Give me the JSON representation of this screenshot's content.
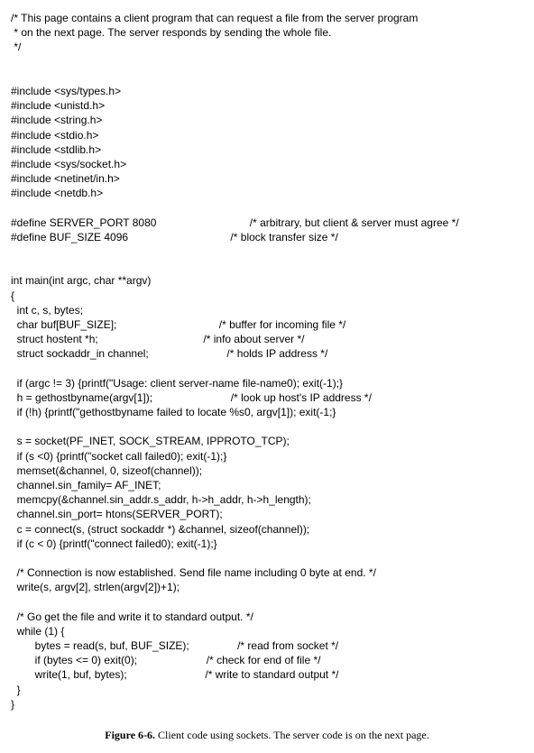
{
  "code": {
    "l01": "/* This page contains a client program that can request a file from the server program",
    "l02": " * on the next page. The server responds by sending the whole file.",
    "l03": " */",
    "l04": "",
    "l05": "",
    "l06": "#include <sys/types.h>",
    "l07": "#include <unistd.h>",
    "l08": "#include <string.h>",
    "l09": "#include <stdio.h>",
    "l10": "#include <stdlib.h>",
    "l11": "#include <sys/socket.h>",
    "l12": "#include <netinet/in.h>",
    "l13": "#include <netdb.h>",
    "l14": "",
    "l15": "#define SERVER_PORT 8080                               /* arbitrary, but client & server must agree */",
    "l16": "#define BUF_SIZE 4096                                  /* block transfer size */",
    "l17": "",
    "l18": "",
    "l19": "int main(int argc, char **argv)",
    "l20": "{",
    "l21": "  int c, s, bytes;",
    "l22": "  char buf[BUF_SIZE];                                  /* buffer for incoming file */",
    "l23": "  struct hostent *h;                                   /* info about server */",
    "l24": "  struct sockaddr_in channel;                          /* holds IP address */",
    "l25": "",
    "l26": "  if (argc != 3) {printf(\"Usage: client server-name file-name0); exit(-1);}",
    "l27": "  h = gethostbyname(argv[1]);                          /* look up host's IP address */",
    "l28": "  if (!h) {printf(\"gethostbyname failed to locate %s0, argv[1]); exit(-1;}",
    "l29": "",
    "l30": "  s = socket(PF_INET, SOCK_STREAM, IPPROTO_TCP);",
    "l31": "  if (s <0) {printf(\"socket call failed0); exit(-1);}",
    "l32": "  memset(&channel, 0, sizeof(channel));",
    "l33": "  channel.sin_family= AF_INET;",
    "l34": "  memcpy(&channel.sin_addr.s_addr, h->h_addr, h->h_length);",
    "l35": "  channel.sin_port= htons(SERVER_PORT);",
    "l36": "  c = connect(s, (struct sockaddr *) &channel, sizeof(channel));",
    "l37": "  if (c < 0) {printf(\"connect failed0); exit(-1);}",
    "l38": "",
    "l39": "  /* Connection is now established. Send file name including 0 byte at end. */",
    "l40": "  write(s, argv[2], strlen(argv[2])+1);",
    "l41": "",
    "l42": "  /* Go get the file and write it to standard output. */",
    "l43": "  while (1) {",
    "l44": "        bytes = read(s, buf, BUF_SIZE);                /* read from socket */",
    "l45": "        if (bytes <= 0) exit(0);                       /* check for end of file */",
    "l46": "        write(1, buf, bytes);                          /* write to standard output */",
    "l47": "  }",
    "l48": "}"
  },
  "caption": {
    "label": "Figure 6-6.  ",
    "text": "Client code using sockets. The server code is on the next page."
  }
}
